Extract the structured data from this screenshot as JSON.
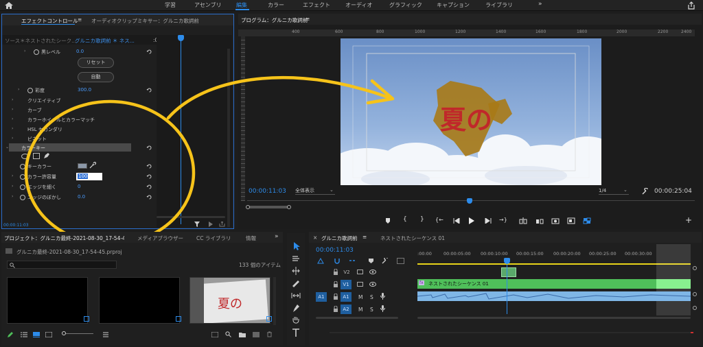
{
  "workspaces": {
    "items": [
      "学習",
      "アセンブリ",
      "編集",
      "カラー",
      "エフェクト",
      "オーディオ",
      "グラフィック",
      "キャプション",
      "ライブラリ"
    ],
    "active_index": 2,
    "more": "»"
  },
  "effect_panel": {
    "tab_active": "エフェクトコントロール",
    "tab_menu": "≡",
    "tab_other": "オーディオクリップミキサー：グルニカ歌詞前",
    "source_label": "ソース＊ネストされたシーク...",
    "clip_label": "グルニカ歌詞前 ＊ ネス...",
    "time_marker": ":00",
    "rows": {
      "black_level_label": "黒レベル",
      "black_level_value": "0.0",
      "reset_label": "リセット",
      "auto_label": "自動",
      "hue_label": "彩度",
      "hue_value": "300.0",
      "creative_label": "クリエイティブ",
      "curves_label": "カーブ",
      "colorwheel_label": "カラーホイールとカラーマッチ",
      "hsl_label": "HSL セカンダリ",
      "vignette_label": "ビネット",
      "colorkey_label": "カラーキー",
      "keycolor_label": "キーカラー",
      "tolerance_label": "カラー許容量",
      "tolerance_value": "100",
      "edge_thin_label": "エッジを細く",
      "edge_thin_value": "0",
      "edge_feather_label": "エッジのぼかし",
      "edge_feather_value": "0.0"
    },
    "timecode": "00:00:11:03"
  },
  "program": {
    "title": "プログラム：グルニカ歌詞前",
    "menu": "≡",
    "timecode_current": "00:00:11:03",
    "fit_label": "全体表示",
    "quality_label": "1/4",
    "timecode_duration": "00:00:25:04",
    "ruler_labels": [
      "400",
      "600",
      "800",
      "1000",
      "1200",
      "1400",
      "1600",
      "1800",
      "2000",
      "2200",
      "2400"
    ],
    "video_text": "夏の"
  },
  "project": {
    "tab_active": "プロジェクト：グルニカ最終-2021-08-30_17-54-4",
    "tab_media": "メディアブラウザー",
    "tab_cc": "CC ライブラリ",
    "tab_info": "情報",
    "file_name": "グルニカ最終-2021-08-30_17-54-45.prproj",
    "item_count": "133 個のアイテム",
    "more": "»"
  },
  "timeline": {
    "close": "×",
    "tab_active": "グルニカ歌詞前",
    "tab_menu": "≡",
    "tab_other": "ネストされたシーケンス 01",
    "timecode": "00:00:11:03",
    "ruler_labels": [
      ":00:00",
      "00:00:05:00",
      "00:00:10:00",
      "00:00:15:00",
      "00:00:20:00",
      "00:00:25:00",
      "00:00:30:00"
    ],
    "tracks": {
      "v2": "V2",
      "v1": "V1",
      "a1_src": "A1",
      "a1": "A1",
      "a2": "A2",
      "m": "M",
      "s": "S"
    },
    "clip_v1": "ネストされたシーケンス 01",
    "clip_v1_fx": "fx"
  },
  "colors": {
    "accent": "#2d8ceb",
    "clip_green": "#4fbf5a",
    "audio_blue": "#7fb6e6",
    "annotation_yellow": "#f6c31a"
  }
}
